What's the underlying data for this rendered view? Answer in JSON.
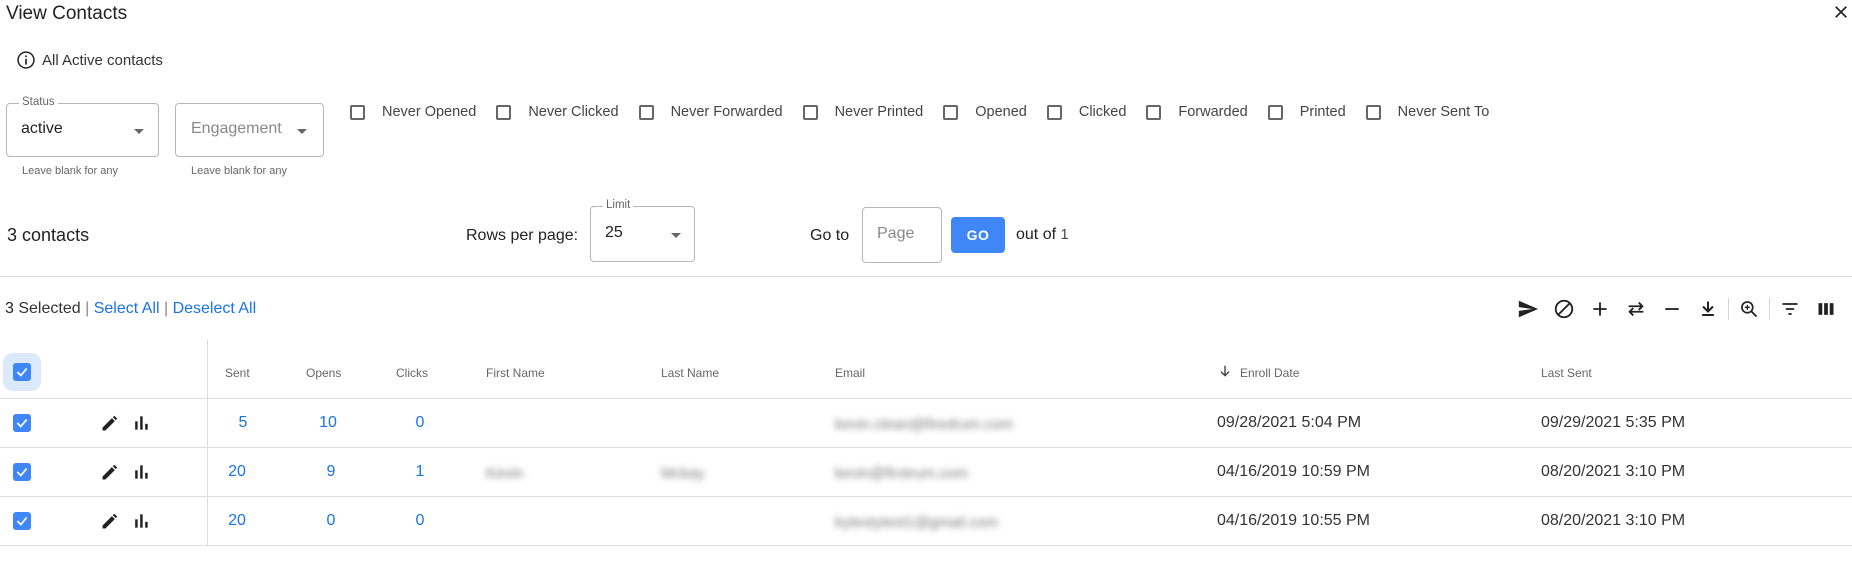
{
  "dialog": {
    "title": "View Contacts"
  },
  "info": {
    "text": "All Active contacts"
  },
  "filters": {
    "status": {
      "legend": "Status",
      "value": "active",
      "helper": "Leave blank for any"
    },
    "engagement": {
      "placeholder": "Engagement",
      "helper": "Leave blank for any"
    },
    "checkboxes": [
      "Never Opened",
      "Never Clicked",
      "Never Forwarded",
      "Never Printed",
      "Opened",
      "Clicked",
      "Forwarded",
      "Printed",
      "Never Sent To"
    ]
  },
  "pager": {
    "count": "3",
    "count_label": "contacts",
    "rows_per_page_label": "Rows per page:",
    "limit_legend": "Limit",
    "limit_value": "25",
    "goto_label": "Go to",
    "page_placeholder": "Page",
    "go_label": "GO",
    "out_of_label": "out of",
    "total_pages": "1"
  },
  "selection": {
    "count": "3",
    "selected_label": "Selected",
    "select_all": "Select All",
    "deselect_all": "Deselect All"
  },
  "toolbar_icons": [
    "send-icon",
    "block-icon",
    "add-icon",
    "swap-icon",
    "remove-icon",
    "download-icon",
    "zoom-icon",
    "filter-icon",
    "columns-icon"
  ],
  "table": {
    "columns": {
      "sent": "Sent",
      "opens": "Opens",
      "clicks": "Clicks",
      "first_name": "First Name",
      "last_name": "Last Name",
      "email": "Email",
      "enroll_date": "Enroll Date",
      "last_sent": "Last Sent"
    },
    "rows": [
      {
        "sent": "5",
        "opens": "10",
        "clicks": "0",
        "first_name": "",
        "last_name": "",
        "email": "kevin.clean@firedrum.com",
        "enroll_date": "09/28/2021 5:04 PM",
        "last_sent": "09/29/2021 5:35 PM"
      },
      {
        "sent": "20",
        "opens": "9",
        "clicks": "1",
        "first_name": "Kevin",
        "last_name": "Mckay",
        "email": "kevin@firstrum.com",
        "enroll_date": "04/16/2019 10:59 PM",
        "last_sent": "08/20/2021 3:10 PM"
      },
      {
        "sent": "20",
        "opens": "0",
        "clicks": "0",
        "first_name": "",
        "last_name": "",
        "email": "kytestytest1@gmail.com",
        "enroll_date": "04/16/2019 10:55 PM",
        "last_sent": "08/20/2021 3:10 PM"
      }
    ]
  },
  "colors": {
    "accent": "#3f86f7",
    "link": "#1a73e8"
  }
}
